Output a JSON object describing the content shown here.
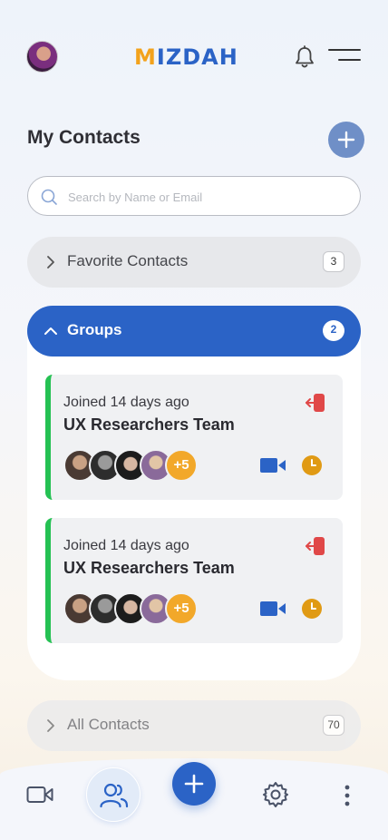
{
  "header": {
    "logo_m": "M",
    "logo_rest": "IZDAH"
  },
  "page": {
    "title": "My Contacts"
  },
  "search": {
    "placeholder": "Search by Name or Email",
    "value": ""
  },
  "sections": {
    "favorites": {
      "label": "Favorite Contacts",
      "count": "3"
    },
    "groups": {
      "label": "Groups",
      "count": "2"
    },
    "all": {
      "label": "All Contacts",
      "count": "70"
    }
  },
  "groups": [
    {
      "joined": "Joined 14 days ago",
      "name": "UX Researchers Team",
      "more_members": "+5"
    },
    {
      "joined": "Joined 14 days ago",
      "name": "UX Researchers Team",
      "more_members": "+5"
    }
  ],
  "colors": {
    "primary": "#2b63c6",
    "accent": "#f3a21b",
    "success": "#25c153",
    "danger": "#e04848",
    "clock": "#e09a14"
  },
  "icons": {
    "header": [
      "avatar",
      "bell-icon",
      "menu-icon"
    ],
    "group_card": [
      "leave-group-icon",
      "video-call-icon",
      "clock-icon"
    ],
    "bottom_nav": [
      "video-icon",
      "contacts-icon",
      "add-icon",
      "settings-icon",
      "more-vertical-icon"
    ]
  }
}
